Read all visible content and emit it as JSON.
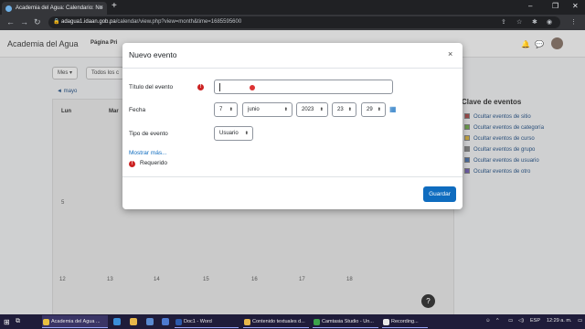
{
  "browser": {
    "tab_title": "Academia del Agua: Calendario: Nu",
    "tab_close": "×",
    "new_tab": "+",
    "url_host": "adagua1.idaan.gob.pa",
    "url_path": "/calendar/view.php?view=month&time=1685595600",
    "window_minimize": "–",
    "window_restore": "❐",
    "window_close": "✕"
  },
  "site": {
    "brand": "Academia del Agua",
    "nav_link": "Página Pri"
  },
  "calendar": {
    "view_select": "Mes ▾",
    "course_select": "Todos los c",
    "prev_month": "◄  mayo",
    "day_names": [
      "Lun",
      "Mar"
    ],
    "day_numbers": [
      "5",
      "12",
      "13",
      "14",
      "15",
      "16",
      "17",
      "18"
    ],
    "key": {
      "title": "Clave de eventos",
      "items": [
        "Ocultar eventos de sitio",
        "Ocultar eventos de categoría",
        "Ocultar eventos de curso",
        "Ocultar eventos de grupo",
        "Ocultar eventos de usuario",
        "Ocultar eventos de otro"
      ],
      "colors": [
        "#9a4a4a",
        "#6a9a4a",
        "#c0a040",
        "#7a7a7a",
        "#4a6a9a",
        "#6a5aa0"
      ]
    },
    "help": "?"
  },
  "modal": {
    "title": "Nuevo evento",
    "close": "×",
    "name_label": "Título del evento",
    "name_value": "",
    "date_label": "Fecha",
    "day": "7",
    "month": "junio",
    "year": "2023",
    "hour": "23",
    "minute": "29",
    "type_label": "Tipo de evento",
    "type_value": "Usuario",
    "show_more": "Mostrar más...",
    "required": "Requerido",
    "save": "Guardar"
  },
  "taskbar": {
    "items": [
      "Academia del Agua ...",
      "Doc1 - Word",
      "Contenido textuales d...",
      "Camtasia Studio - Un...",
      "Recording..."
    ],
    "lang": "ESP",
    "time": "12:29 a. m."
  }
}
